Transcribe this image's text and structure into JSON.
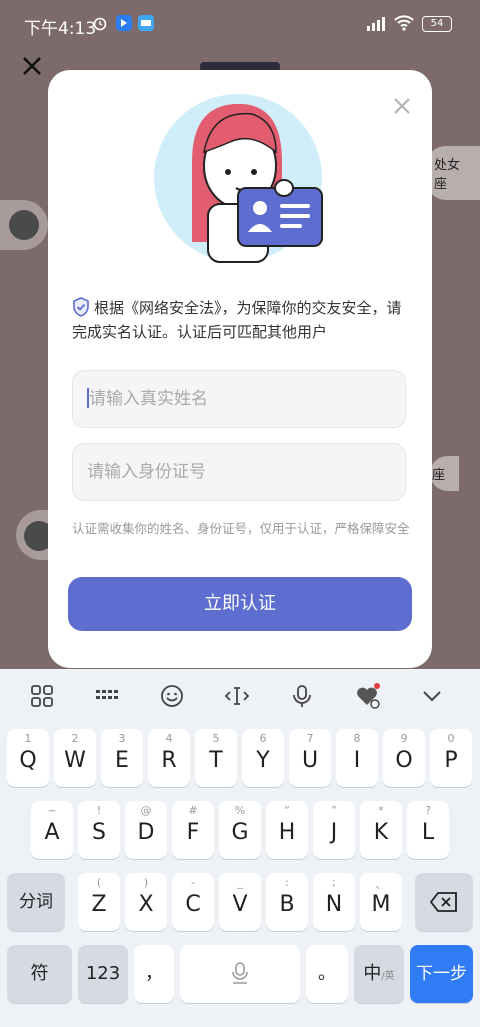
{
  "status_bar": {
    "time": "下午4:13",
    "battery": "54"
  },
  "background": {
    "right_tag_1": "处女座",
    "right_tag_2": "座"
  },
  "modal": {
    "notice_text": "根据《网络安全法》，为保障你的交友安全，请完成实名认证。认证后可匹配其他用户",
    "name_placeholder": "请输入真实姓名",
    "id_placeholder": "请输入身份证号",
    "privacy_text": "认证需收集你的姓名、身份证号，仅用于认证，严格保障安全",
    "submit_label": "立即认证"
  },
  "keyboard": {
    "row1": [
      {
        "sub": "1",
        "key": "Q"
      },
      {
        "sub": "2",
        "key": "W"
      },
      {
        "sub": "3",
        "key": "E"
      },
      {
        "sub": "4",
        "key": "R"
      },
      {
        "sub": "5",
        "key": "T"
      },
      {
        "sub": "6",
        "key": "Y"
      },
      {
        "sub": "7",
        "key": "U"
      },
      {
        "sub": "8",
        "key": "I"
      },
      {
        "sub": "9",
        "key": "O"
      },
      {
        "sub": "0",
        "key": "P"
      }
    ],
    "row2": [
      {
        "sub": "~",
        "key": "A"
      },
      {
        "sub": "!",
        "key": "S"
      },
      {
        "sub": "@",
        "key": "D"
      },
      {
        "sub": "#",
        "key": "F"
      },
      {
        "sub": "%",
        "key": "G"
      },
      {
        "sub": "“",
        "key": "H"
      },
      {
        "sub": "”",
        "key": "J"
      },
      {
        "sub": "*",
        "key": "K"
      },
      {
        "sub": "?",
        "key": "L"
      }
    ],
    "row3": [
      {
        "sub": "(",
        "key": "Z"
      },
      {
        "sub": ")",
        "key": "X"
      },
      {
        "sub": "-",
        "key": "C"
      },
      {
        "sub": "_",
        "key": "V"
      },
      {
        "sub": ":",
        "key": "B"
      },
      {
        "sub": ";",
        "key": "N"
      },
      {
        "sub": "、",
        "key": "M"
      }
    ],
    "fenci": "分词",
    "fu": "符",
    "num": "123",
    "comma": "，",
    "period": "。",
    "zhong": "中",
    "ying": "/英",
    "next": "下一步"
  }
}
